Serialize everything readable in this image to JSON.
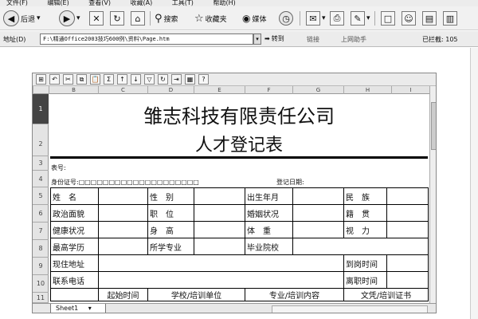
{
  "menu": [
    "文件(F)",
    "编辑(E)",
    "查看(V)",
    "收藏(A)",
    "工具(T)",
    "帮助(H)"
  ],
  "toolbar": {
    "back_label": "后退",
    "search_label": "搜索",
    "favorites_label": "收藏夹",
    "media_label": "媒体"
  },
  "address": {
    "label": "地址(D)",
    "value": "F:\\精通Office2003技巧600例\\资料\\Page.htm",
    "go_label": "转到",
    "links_label": "链接",
    "helper_label": "上网助手",
    "blocked_label": "已拦截: 105"
  },
  "sheet": {
    "columns": [
      "B",
      "C",
      "D",
      "E",
      "F",
      "G",
      "H",
      "I"
    ],
    "rows": [
      "1",
      "2",
      "3",
      "4",
      "5",
      "6",
      "7",
      "8",
      "9",
      "10",
      "11"
    ],
    "title1": "雏志科技有限责任公司",
    "title2": "人才登记表",
    "serial_label": "表号:",
    "id_label": "身份证号:□□□□□□□□□□□□□□□□□□□□",
    "date_label": "登记日期:",
    "grid": {
      "r1": [
        "姓　名",
        "",
        "性　别",
        "",
        "出生年月",
        "",
        "民　族",
        ""
      ],
      "r2": [
        "政治面貌",
        "",
        "职　位",
        "",
        "婚姻状况",
        "",
        "籍　贯",
        ""
      ],
      "r3": [
        "健康状况",
        "",
        "身　高",
        "",
        "体　重",
        "",
        "视　力",
        ""
      ],
      "r4": [
        "最高学历",
        "",
        "所学专业",
        "",
        "毕业院校",
        ""
      ],
      "r5": [
        "现住地址",
        "",
        "到岗时间",
        ""
      ],
      "r6": [
        "联系电话",
        "",
        "离职时间",
        ""
      ],
      "r7": [
        "",
        "起始时间",
        "学校/培训单位",
        "专业/培训内容",
        "文凭/培训证书"
      ]
    },
    "tab_name": "Sheet1"
  }
}
